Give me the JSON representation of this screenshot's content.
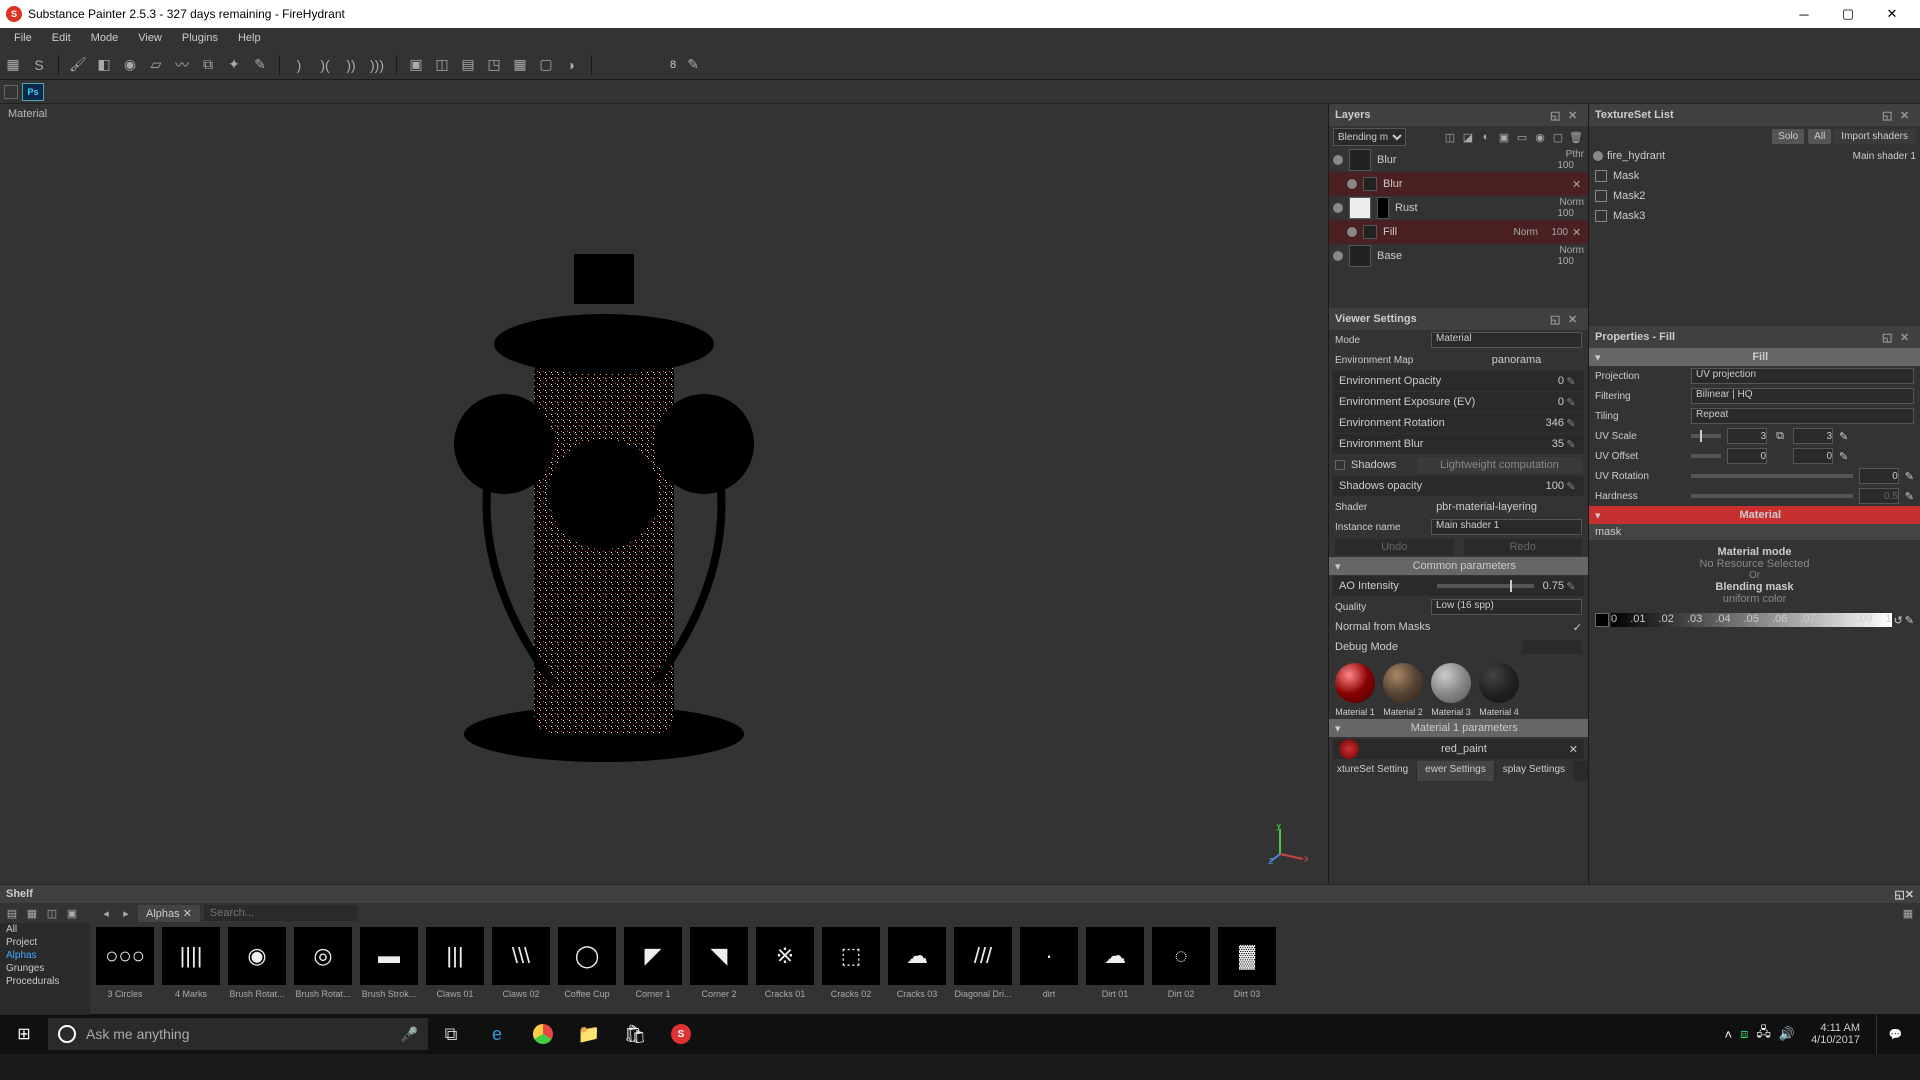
{
  "titlebar": {
    "text": "Substance Painter 2.5.3 - 327 days remaining - FireHydrant"
  },
  "menu": [
    "File",
    "Edit",
    "Mode",
    "View",
    "Plugins",
    "Help"
  ],
  "subbar_badge": "Ps",
  "toolbar_val": "8",
  "viewport_label": "Material",
  "layers": {
    "title": "Layers",
    "blending": "Blending m",
    "rows": [
      {
        "name": "Blur",
        "mode": "Pthr",
        "val": "100",
        "sub": false,
        "sel": false
      },
      {
        "name": "Blur",
        "mode": "",
        "val": "",
        "sub": true,
        "sel": true,
        "close": true
      },
      {
        "name": "Rust",
        "mode": "Norm",
        "val": "100",
        "sub": false,
        "sel": false
      },
      {
        "name": "Fill",
        "mode": "Norm",
        "val": "100",
        "sub": true,
        "sel": true,
        "close": true
      },
      {
        "name": "Base",
        "mode": "Norm",
        "val": "100",
        "sub": false,
        "sel": false
      }
    ]
  },
  "textureset": {
    "title": "TextureSet List",
    "solo": "Solo",
    "all": "All",
    "import": "Import shaders",
    "name": "fire_hydrant",
    "shader": "Main shader 1",
    "masks": [
      "Mask",
      "Mask2",
      "Mask3"
    ]
  },
  "viewer": {
    "title": "Viewer Settings",
    "mode_label": "Mode",
    "mode_val": "Material",
    "envmap_label": "Environment Map",
    "envmap_val": "panorama",
    "rows": [
      {
        "label": "Environment Opacity",
        "val": "0"
      },
      {
        "label": "Environment Exposure (EV)",
        "val": "0"
      },
      {
        "label": "Environment Rotation",
        "val": "346"
      },
      {
        "label": "Environment Blur",
        "val": "35"
      }
    ],
    "shadows_label": "Shadows",
    "shadows_comp": "Lightweight computation",
    "shadows_op_label": "Shadows opacity",
    "shadows_op_val": "100",
    "shader_label": "Shader",
    "shader_val": "pbr-material-layering",
    "instance_label": "Instance name",
    "instance_val": "Main shader 1",
    "undo": "Undo",
    "redo": "Redo",
    "common_header": "Common parameters",
    "ao_label": "AO Intensity",
    "ao_val": "0.75",
    "quality_label": "Quality",
    "quality_val": "Low (16 spp)",
    "normal_masks": "Normal from Masks",
    "debug": "Debug Mode",
    "materials": [
      "Material 1",
      "Material 2",
      "Material 3",
      "Material 4"
    ],
    "m1params": "Material 1 parameters",
    "red_paint": "red_paint",
    "tabs": [
      "xtureSet Setting",
      "ewer Settings",
      "splay Settings"
    ]
  },
  "properties": {
    "title": "Properties - Fill",
    "fill_header": "Fill",
    "projection": {
      "label": "Projection",
      "val": "UV projection"
    },
    "filtering": {
      "label": "Filtering",
      "val": "Bilinear | HQ"
    },
    "tiling": {
      "label": "Tiling",
      "val": "Repeat"
    },
    "uvscale": {
      "label": "UV Scale",
      "v1": "3",
      "v2": "3"
    },
    "uvoffset": {
      "label": "UV Offset",
      "v1": "0",
      "v2": "0"
    },
    "uvrotation": {
      "label": "UV Rotation",
      "val": "0"
    },
    "hardness": {
      "label": "Hardness",
      "val": "0.5"
    },
    "material_header": "Material",
    "mask_label": "mask",
    "matmode": "Material mode",
    "noresource": "No Resource Selected",
    "or": "Or",
    "blendmask": "Blending mask",
    "uniform": "uniform color"
  },
  "shelf": {
    "title": "Shelf",
    "tab": "Alphas",
    "search": "Search...",
    "cats": [
      "All",
      "Project",
      "Alphas",
      "Grunges",
      "Procedurals"
    ],
    "active_cat": "Alphas",
    "items": [
      "3 Circles",
      "4 Marks",
      "Brush Rotat...",
      "Brush Rotat...",
      "Brush Strok...",
      "Claws 01",
      "Claws 02",
      "Coffee Cup",
      "Corner 1",
      "Corner 2",
      "Cracks 01",
      "Cracks 02",
      "Cracks 03",
      "Diagonal Dri...",
      "dirt",
      "Dirt 01",
      "Dirt 02",
      "Dirt 03"
    ]
  },
  "taskbar": {
    "search": "Ask me anything",
    "time": "4:11 AM",
    "date": "4/10/2017"
  }
}
